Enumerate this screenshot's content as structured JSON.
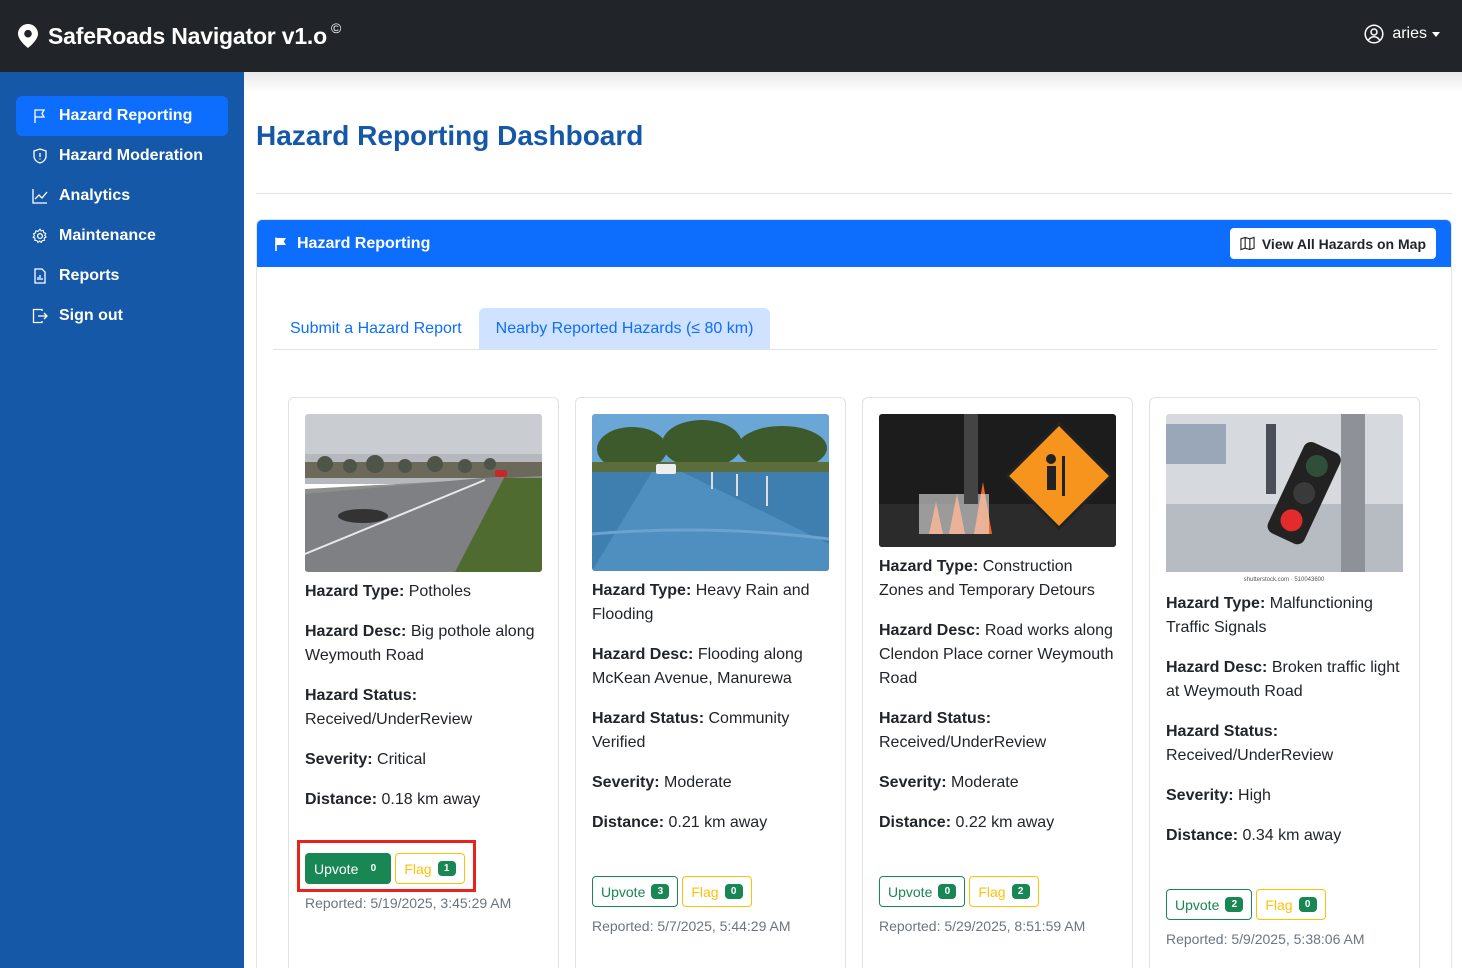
{
  "app": {
    "title": "SafeRoads Navigator v1.o",
    "copyright": "©",
    "user": "aries"
  },
  "sidebar": {
    "items": [
      {
        "label": "Hazard Reporting",
        "icon": "flag-icon"
      },
      {
        "label": "Hazard Moderation",
        "icon": "shield-icon"
      },
      {
        "label": "Analytics",
        "icon": "chart-line-icon"
      },
      {
        "label": "Maintenance",
        "icon": "gear-icon"
      },
      {
        "label": "Reports",
        "icon": "report-icon"
      },
      {
        "label": "Sign out",
        "icon": "sign-out-icon"
      }
    ]
  },
  "page": {
    "title": "Hazard Reporting Dashboard"
  },
  "panel": {
    "title": "Hazard Reporting",
    "map_button": "View All Hazards on Map",
    "tabs": [
      "Submit a Hazard Report",
      "Nearby Reported Hazards (≤ 80 km)"
    ]
  },
  "labels": {
    "type": "Hazard Type:",
    "desc": "Hazard Desc:",
    "status": "Hazard Status:",
    "severity": "Severity:",
    "distance": "Distance:",
    "upvote": "Upvote",
    "flag": "Flag"
  },
  "hazards": [
    {
      "type": "Potholes",
      "desc": "Big pothole along Weymouth Road",
      "status": "Received/UnderReview",
      "severity": "Critical",
      "distance": "0.18 km away",
      "upvotes": "0",
      "flags": "1",
      "reported": "Reported: 5/19/2025, 3:45:29 AM"
    },
    {
      "type": "Heavy Rain and Flooding",
      "desc": "Flooding along McKean Avenue, Manurewa",
      "status": "Community Verified",
      "severity": "Moderate",
      "distance": "0.21 km away",
      "upvotes": "3",
      "flags": "0",
      "reported": "Reported: 5/7/2025, 5:44:29 AM"
    },
    {
      "type": "Construction Zones and Temporary Detours",
      "desc": "Road works along Clendon Place corner Weymouth Road",
      "status": "Received/UnderReview",
      "severity": "Moderate",
      "distance": "0.22 km away",
      "upvotes": "0",
      "flags": "2",
      "reported": "Reported: 5/29/2025, 8:51:59 AM"
    },
    {
      "type": "Malfunctioning Traffic Signals",
      "desc": "Broken traffic light at Weymouth Road",
      "status": "Received/UnderReview",
      "severity": "High",
      "distance": "0.34 km away",
      "upvotes": "2",
      "flags": "0",
      "reported": "Reported: 5/9/2025, 5:38:06 AM"
    }
  ],
  "image_credit": "shutterstock.com · 510043600",
  "colors": {
    "navbar": "#212529",
    "sidebar": "#1558a8",
    "primary": "#0d6efd",
    "success": "#198754",
    "warning": "#ffc107",
    "highlight": "#e8221c"
  }
}
